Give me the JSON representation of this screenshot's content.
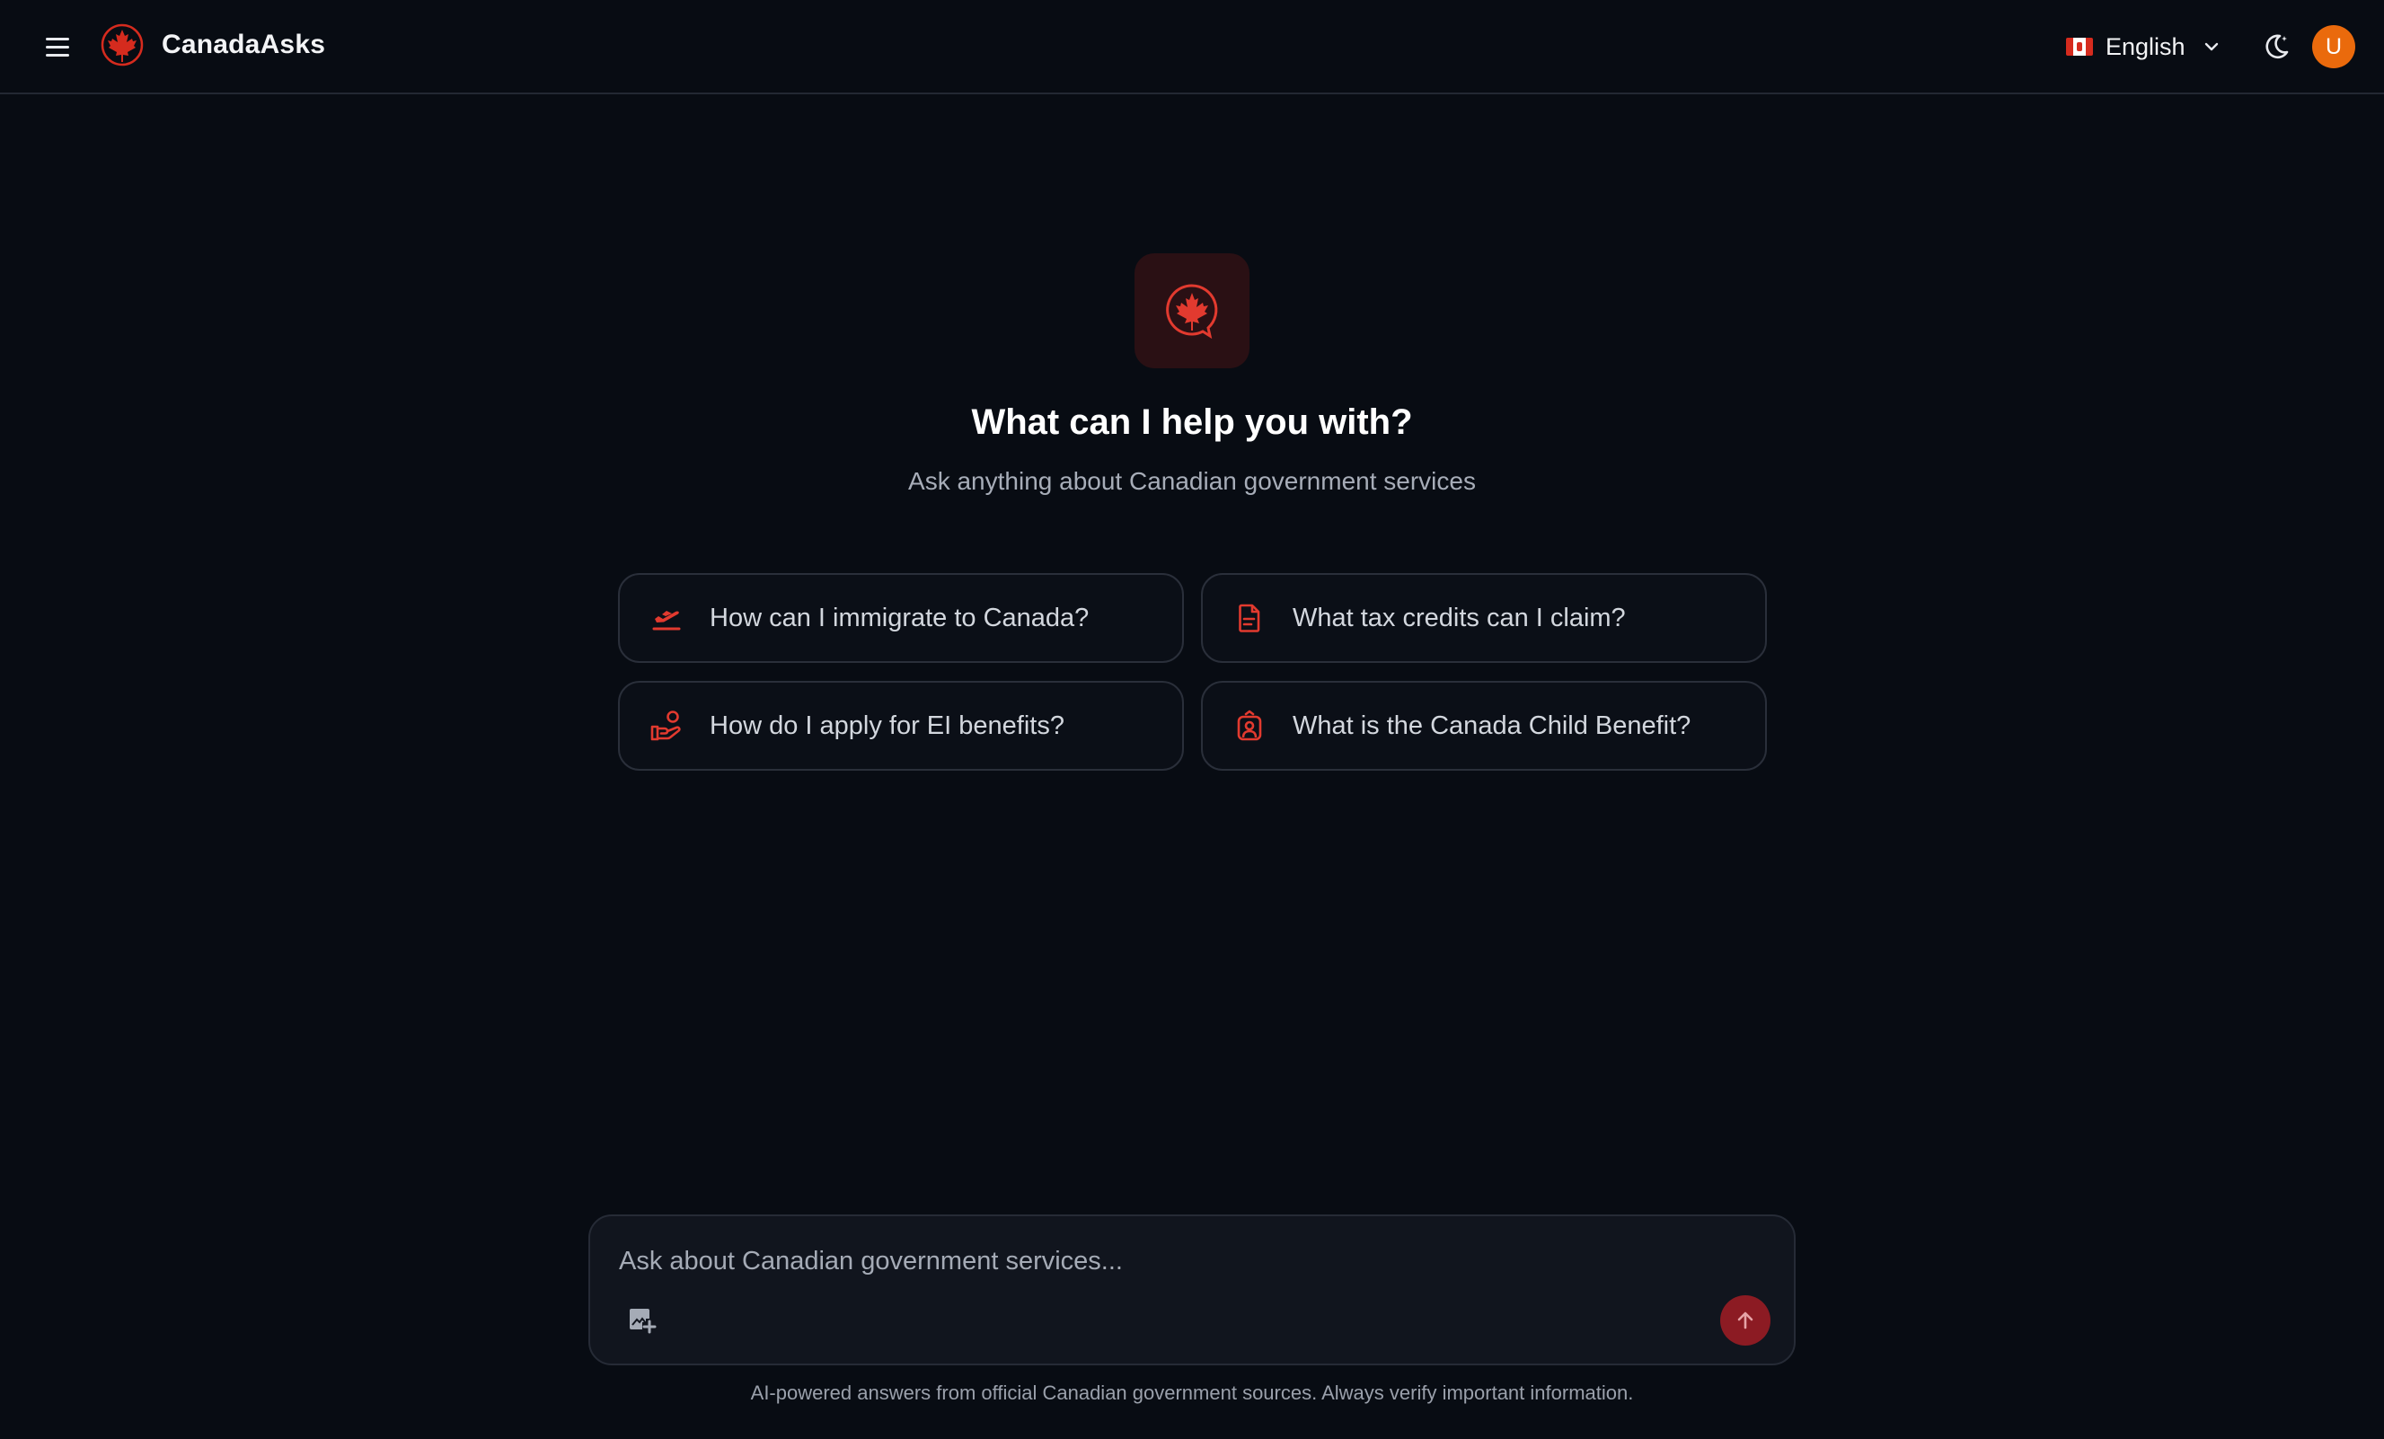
{
  "app": {
    "name": "CanadaAsks"
  },
  "header": {
    "menu_icon": "hamburger-menu-icon",
    "logo_icon": "maple-leaf-logo-icon",
    "language": {
      "label": "English",
      "flag": "canada-flag-icon"
    },
    "theme_icon": "moon-icon",
    "avatar_initial": "U"
  },
  "hero": {
    "icon": "maple-leaf-chat-icon",
    "title": "What can I help you with?",
    "subtitle": "Ask anything about Canadian government services"
  },
  "suggestions": [
    {
      "label": "How can I immigrate to Canada?",
      "icon": "plane-departure-icon"
    },
    {
      "label": "What tax credits can I claim?",
      "icon": "document-icon"
    },
    {
      "label": "How do I apply for EI benefits?",
      "icon": "hand-person-icon"
    },
    {
      "label": "What is the Canada Child Benefit?",
      "icon": "person-badge-icon"
    }
  ],
  "composer": {
    "placeholder": "Ask about Canadian government services...",
    "value": "",
    "attach_icon": "add-image-icon",
    "send_icon": "arrow-up-icon"
  },
  "footer": {
    "disclaimer": "AI-powered answers from official Canadian government sources. Always verify important information."
  },
  "colors": {
    "background": "#080c13",
    "accent": "#d52b1e",
    "send_button": "#8c1b23",
    "avatar": "#ea6a0c"
  }
}
